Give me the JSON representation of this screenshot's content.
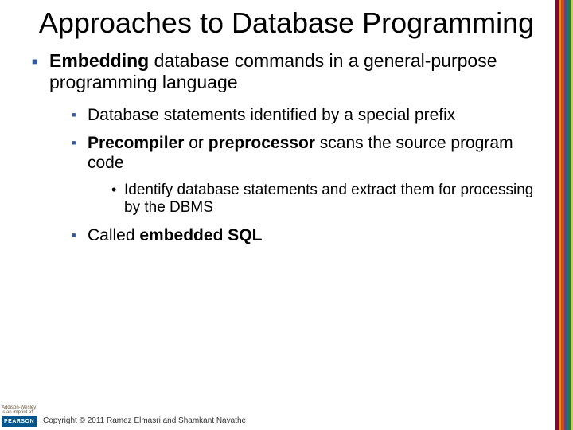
{
  "title": "Approaches to Database Programming",
  "bullets": {
    "l1_a_bold": "Embedding",
    "l1_a_rest": " database commands in a general-purpose programming language",
    "l2_a": "Database statements identified by a special prefix",
    "l2_b_bold": "Precompiler",
    "l2_b_mid": " or ",
    "l2_b_bold2": "preprocessor",
    "l2_b_rest": " scans the source program code",
    "l3_a": "Identify database statements and extract them for processing by the DBMS",
    "l2_c_pre": "Called ",
    "l2_c_bold": "embedded SQL"
  },
  "footer": {
    "copyright": "Copyright © 2011 Ramez Elmasri and Shamkant Navathe",
    "logo_top": "Addison-Wesley is an imprint of",
    "logo_label": "PEARSON"
  }
}
